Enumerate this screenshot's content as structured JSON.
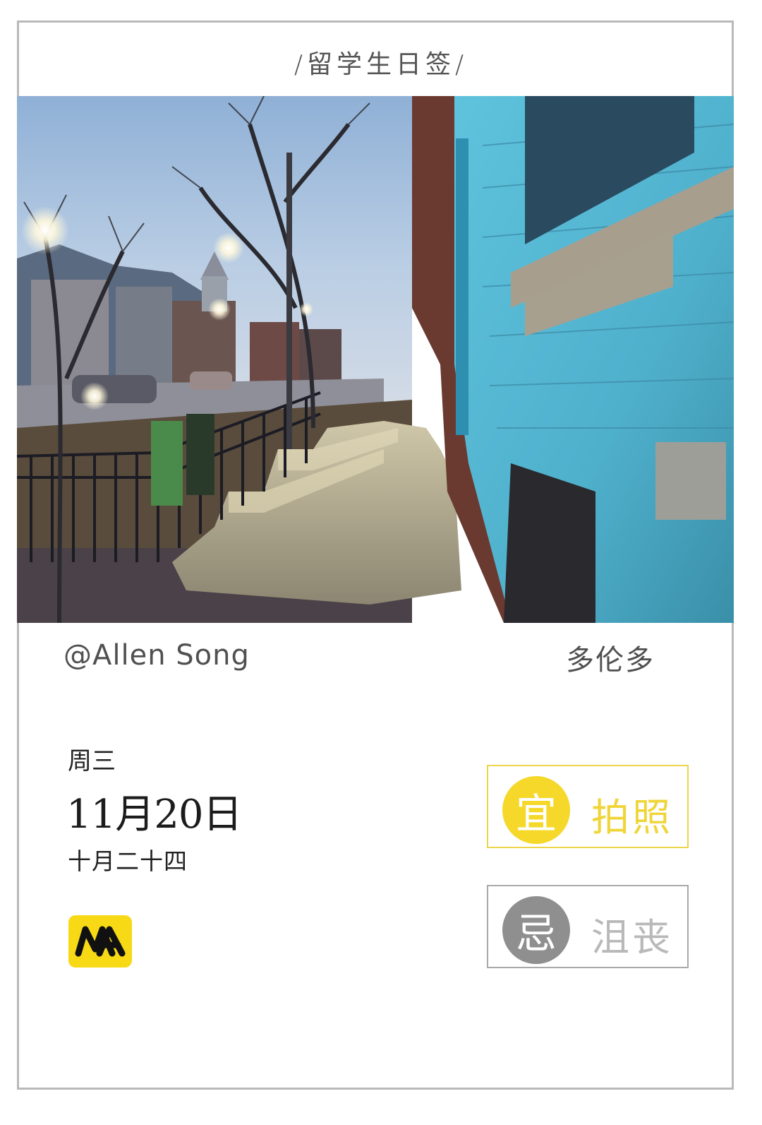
{
  "header": {
    "title": "/留学生日签/"
  },
  "photo": {
    "subject": "street-photo"
  },
  "author": "@Allen Song",
  "city": "多伦多",
  "date": {
    "weekday": "周三",
    "solar": "11月20日",
    "lunar": "十月二十四"
  },
  "logo": {
    "text": "MA",
    "color": "#f7d915"
  },
  "yi": {
    "label": "宜",
    "activity": "拍照",
    "color": "#f6d82a"
  },
  "ji": {
    "label": "忌",
    "activity": "沮丧",
    "color": "#8f8f8f"
  }
}
